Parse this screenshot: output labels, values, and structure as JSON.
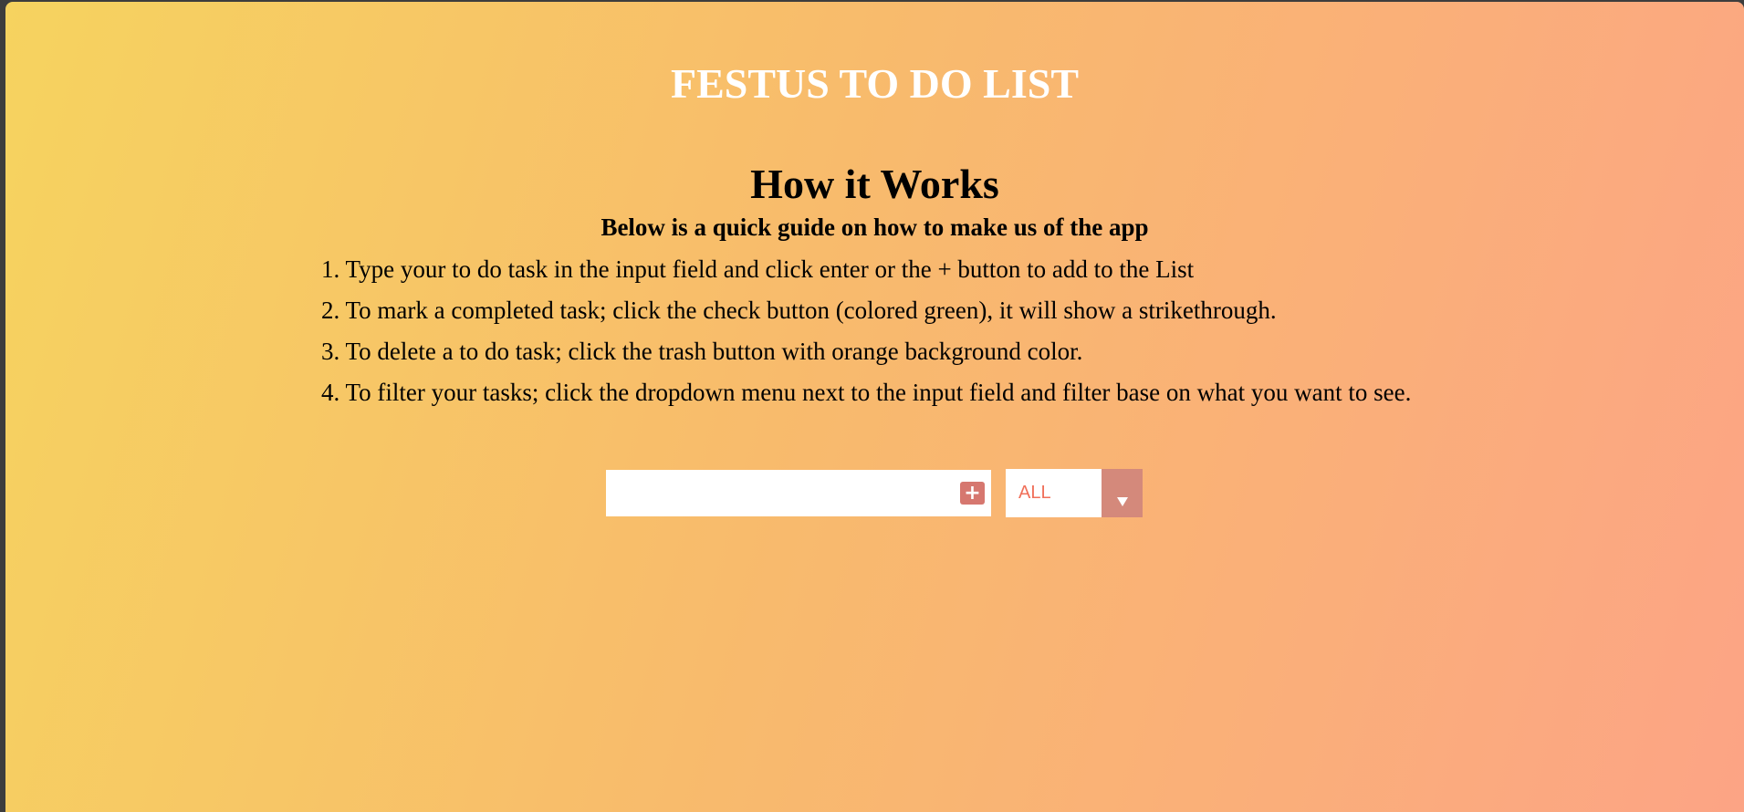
{
  "header": {
    "title": "FESTUS TO DO LIST"
  },
  "guide": {
    "heading": "How it Works",
    "subheading": "Below is a quick guide on how to make us of the app",
    "steps": [
      "1. Type your to do task in the input field and click enter or the + button to add to the List",
      "2. To mark a completed task; click the check button (colored green), it will show a strikethrough.",
      "3. To delete a to do task; click the trash button with orange background color.",
      "4. To filter your tasks; click the dropdown menu next to the input field and filter base on what you want to see."
    ]
  },
  "form": {
    "input_value": "",
    "add_icon": "plus-icon",
    "add_label": "+",
    "filter_selected": "ALL",
    "filter_icon": "chevron-down-icon"
  },
  "colors": {
    "gradient_start": "#f6d35f",
    "gradient_end": "#fca485",
    "title_color": "#ffffff",
    "add_button": "#d6776f",
    "filter_text": "#f0705a",
    "filter_arrow_bg": "#d4897b"
  }
}
